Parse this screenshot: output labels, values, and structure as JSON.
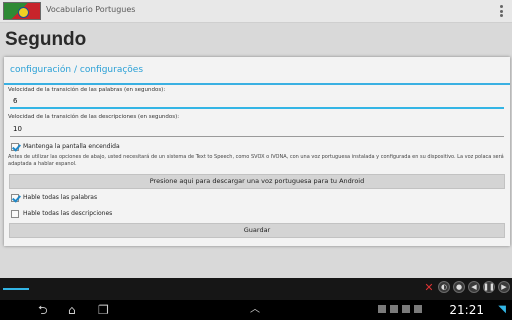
{
  "app": {
    "title": "Vocabulario Portugues",
    "overflow_icon": "overflow-menu-icon"
  },
  "screen": {
    "heading": "Segundo"
  },
  "dialog": {
    "title": "configuración / configurações",
    "word_speed": {
      "label": "Velocidad de la transición de las palabras (en segundos):",
      "value": "6"
    },
    "desc_speed": {
      "label": "Velocidad de la transición de las descripciones (en segundos):",
      "value": "10"
    },
    "screen_on": {
      "label": "Mantenga la pantalla encendida",
      "checked": true
    },
    "notice": "Antes de utilizar las opciones de abajo, usted necesitará de un sistema de Text to Speech, como SVOX o IVONA, con una voz portuguesa instalada y configurada en su dispositivo. La voz polaca será adaptada a hablar espanol.",
    "download_button": "Presione aqui para descargar una voz portuguesa para tu Android",
    "speak_words": {
      "label": "Hable todas las palabras",
      "checked": true
    },
    "speak_descriptions": {
      "label": "Hable todas las descripciones",
      "checked": false
    },
    "save_button": "Guardar"
  },
  "statusbar": {
    "time": "21:21"
  },
  "colors": {
    "accent": "#33b5e5",
    "dialog_title": "#2aa0d6"
  }
}
